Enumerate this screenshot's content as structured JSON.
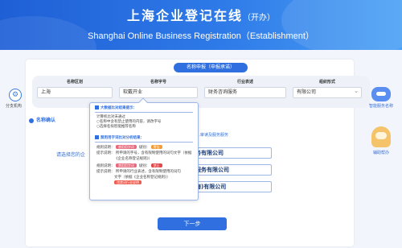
{
  "header": {
    "title": "上海企业登记在线",
    "title_suffix": "（开办）",
    "subtitle": "Shanghai Online Business Registration（Establishment）"
  },
  "left_rail": {
    "icon": "gear-icon",
    "label": "分支机构"
  },
  "right_rail": {
    "robot_icon": "robot-icon",
    "robot_label": "智能服务名称",
    "helper_icon": "assistant-icon",
    "helper_label": "辅助帮办"
  },
  "form": {
    "section_label": "名称申报（申报承诺）",
    "fields": [
      {
        "label": "名称区划",
        "value": "上海"
      },
      {
        "label": "名称字号",
        "value": "软戴开业"
      },
      {
        "label": "行业表述",
        "value": "财务咨询服务"
      },
      {
        "label": "组织形式",
        "value": "有限公司"
      }
    ]
  },
  "name_confirm": {
    "title": "名称确认",
    "hint": "…审读及服务服务",
    "prompt": "请选择您的企",
    "options": [
      "务有限公司",
      "服务有限公司",
      "海)有限公司"
    ]
  },
  "popup": {
    "section1_title": "大数据比对结果提示：",
    "lines": [
      "计算机比对未通过",
      "○名称中含有禁止使用的内容，请改字号",
      "○选择名拟智能推荐名称"
    ],
    "section2_title": "禁用用字词比对分析结果：",
    "rows": [
      {
        "k1": "规则说明：",
        "tag1": "禁用用字词",
        "k2": "级别：",
        "tag2": "警告"
      },
      {
        "text": "提示说明：  所申请的字号，含有限制使用的词句文字（依据"
      },
      {
        "text": "《企业名称登记规则》）"
      },
      {
        "k1": "规则说明：",
        "tag1": "禁用用字词",
        "k2": "级别：",
        "tag2": "禁止"
      },
      {
        "text": "提示说明：  所申请的行业表述，含有限制使用的词句"
      },
      {
        "text": "文字（依据《企业名称登记规则》）"
      },
      {
        "tag_only": "违禁词行业说明"
      }
    ]
  },
  "actions": {
    "next_label": "下一步"
  },
  "colors": {
    "primary": "#2f6fdf",
    "banner_start": "#1f5fd6",
    "banner_end": "#4aa0f5",
    "warn": "#f29b38",
    "danger": "#e0484a"
  }
}
